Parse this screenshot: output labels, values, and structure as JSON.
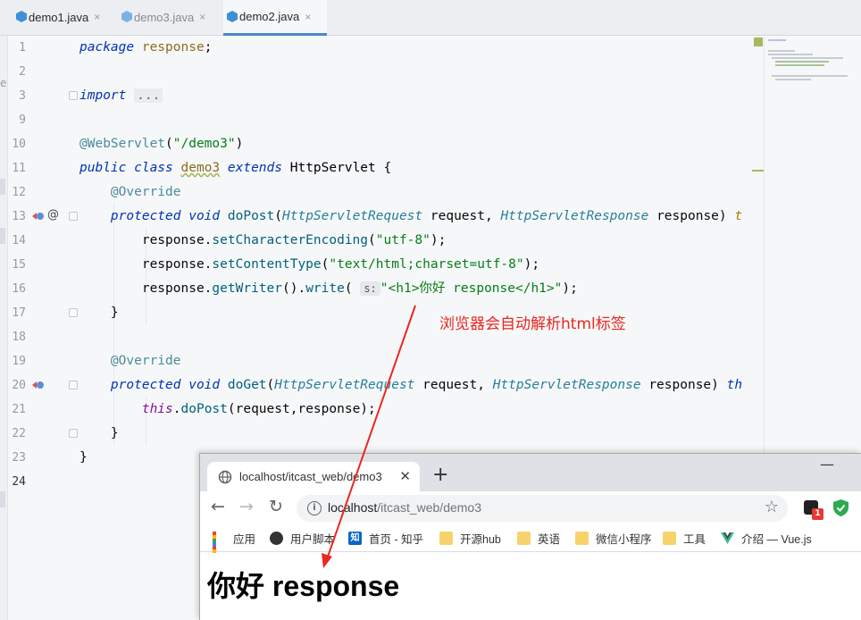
{
  "ide": {
    "tabs": [
      {
        "label": "demo1.java",
        "close": "×",
        "active": false
      },
      {
        "label": "demo3.java",
        "close": "×",
        "active": false
      },
      {
        "label": "demo2.java",
        "close": "×",
        "active": true
      }
    ],
    "left_strip_label": "e",
    "line_numbers": [
      "1",
      "2",
      "3",
      "9",
      "10",
      "11",
      "12",
      "13",
      "14",
      "15",
      "16",
      "17",
      "18",
      "19",
      "20",
      "21",
      "22",
      "23",
      "24"
    ],
    "code": {
      "l1_kw": "package",
      "l1_pkg": "response",
      "l1_semi": ";",
      "l3_kw": "import",
      "l3_fold": "...",
      "l10_ann": "@WebServlet",
      "l10_open": "(",
      "l10_str": "\"/demo3\"",
      "l10_close": ")",
      "l11_kw1": "public class",
      "l11_cls": "demo3",
      "l11_kw2": "extends",
      "l11_super": "HttpServlet",
      "l11_brace": "{",
      "l12_ann": "@Override",
      "l13_kw": "protected void",
      "l13_meth": "doPost",
      "l13_p1t": "HttpServletRequest",
      "l13_p1n": "request,",
      "l13_p2t": "HttpServletResponse",
      "l13_p2n": "response)",
      "l13_tail": "t",
      "l14_obj": "response.",
      "l14_meth": "setCharacterEncoding",
      "l14_str": "\"utf-8\"",
      "l14_end": ");",
      "l15_obj": "response.",
      "l15_meth": "setContentType",
      "l15_str": "\"text/html;charset=utf-8\"",
      "l15_end": ");",
      "l16_obj": "response.",
      "l16_meth1": "getWriter",
      "l16_mid": "().",
      "l16_meth2": "write",
      "l16_hint": "s:",
      "l16_str": "\"<h1>你好 response</h1>\"",
      "l16_end": ");",
      "l17": "}",
      "l19_ann": "@Override",
      "l20_kw": "protected void",
      "l20_meth": "doGet",
      "l20_p1t": "HttpServletRequest",
      "l20_p1n": "request,",
      "l20_p2t": "HttpServletResponse",
      "l20_p2n": "response)",
      "l20_tail": "th",
      "l21_this": "this",
      "l21_meth": "doPost",
      "l21_args": "(request,response);",
      "l22": "}",
      "l23": "}"
    },
    "gutter_at": "@",
    "annotation_text": "浏览器会自动解析html标签"
  },
  "browser": {
    "tab_title": "localhost/itcast_web/demo3",
    "tab_close": "✕",
    "new_tab": "+",
    "minimize": "—",
    "back": "←",
    "forward": "→",
    "reload": "↻",
    "info": "i",
    "url_host": "localhost",
    "url_path": "/itcast_web/demo3",
    "star": "☆",
    "extension_badge": "1",
    "bookmarks": [
      {
        "label": "应用",
        "icon": "apps-grid-icon"
      },
      {
        "label": "用户脚本",
        "icon": "user-script-icon"
      },
      {
        "label": "首页 - 知乎",
        "icon": "zhihu-icon",
        "glyph": "知"
      },
      {
        "label": "开源hub",
        "icon": "folder-icon"
      },
      {
        "label": "英语",
        "icon": "folder-icon"
      },
      {
        "label": "微信小程序",
        "icon": "folder-icon"
      },
      {
        "label": "工具",
        "icon": "folder-icon"
      },
      {
        "label": "介绍 — Vue.js",
        "icon": "vue-icon"
      }
    ],
    "page_heading": "你好 response"
  },
  "colors": {
    "accent_tab": "#4a88c7",
    "annotation_red": "#e8281f",
    "keyword": "#0033b3",
    "string": "#067d17",
    "annotation_code": "#4a8c9c"
  }
}
